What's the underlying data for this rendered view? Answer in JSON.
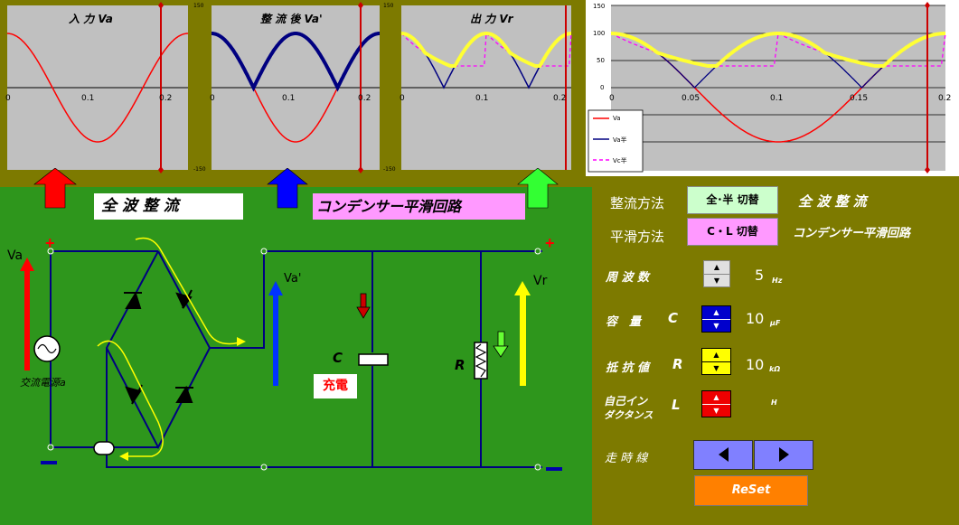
{
  "colors": {
    "background": "#7d7a00",
    "panel": "#2e961c",
    "plot_bg": "#c0c0c0",
    "input": "#ff0000",
    "fullwave": "#000080",
    "output": "#ffff00",
    "capacitor": "#ff00ff",
    "button_rect": "#ccffcc",
    "button_smooth": "#ff99ff",
    "reset": "#ff8000"
  },
  "charts": {
    "input": {
      "title": "入 力 Va",
      "y_top": "150",
      "y_bottom": "-150",
      "x_ticks": [
        "0",
        "0.1",
        "0.2"
      ]
    },
    "rectified": {
      "title": "整 流 後 Va'",
      "y_top": "150",
      "y_bottom": "-150",
      "x_ticks": [
        "0",
        "0.1",
        "0.2"
      ]
    },
    "output": {
      "title": "出 力 Vr",
      "y_top": "150",
      "y_bottom": "-150",
      "x_ticks": [
        "0",
        "0.1",
        "0.2"
      ]
    },
    "large": {
      "y_ticks": [
        "150",
        "100",
        "50",
        "0"
      ],
      "x_ticks": [
        "0",
        "0.05",
        "0.1",
        "0.15",
        "0.2"
      ],
      "legend": [
        "Va",
        "Va半",
        "Vc半"
      ]
    }
  },
  "chart_data": {
    "type": "line",
    "x": [
      0,
      0.05,
      0.1,
      0.15,
      0.2
    ],
    "xlim": [
      0,
      0.2
    ],
    "ylim": [
      -150,
      150
    ],
    "series": [
      {
        "name": "Va",
        "shape": "sine",
        "amplitude": 100,
        "frequency_hz": 5
      },
      {
        "name": "Va半",
        "shape": "full-wave rectified sine",
        "amplitude": 100
      },
      {
        "name": "Vc半",
        "shape": "capacitor-smoothed ripple",
        "peak": 100,
        "trough": 40
      }
    ],
    "cursor_x": 0.19
  },
  "circuit": {
    "mode_label": "全 波 整 流",
    "smoothing_label": "コンデンサー平滑回路",
    "va": "Va",
    "va_prime": "Va'",
    "vr": "Vr",
    "plus": "+",
    "minus": "−",
    "source": "交流電源a",
    "capacitor": "C",
    "charge": "充電",
    "resistor": "R"
  },
  "controls": {
    "rect_method_label": "整流方法",
    "rect_button": "全･半 切替",
    "rect_value": "全 波 整 流",
    "smooth_method_label": "平滑方法",
    "smooth_button": "C・L 切替",
    "smooth_value": "コンデンサー平滑回路",
    "freq_label": "周 波 数",
    "freq_value": "5",
    "freq_unit": "Hz",
    "cap_label": "容　量",
    "cap_symbol": "C",
    "cap_value": "10",
    "cap_unit": "μF",
    "res_label": "抵 抗 値",
    "res_symbol": "R",
    "res_value": "10",
    "res_unit": "kΩ",
    "ind_label_1": "自己イン",
    "ind_label_2": "ダクタンス",
    "ind_symbol": "L",
    "ind_unit": "H",
    "scan_label": "走 時 線",
    "reset": "ReSet"
  }
}
